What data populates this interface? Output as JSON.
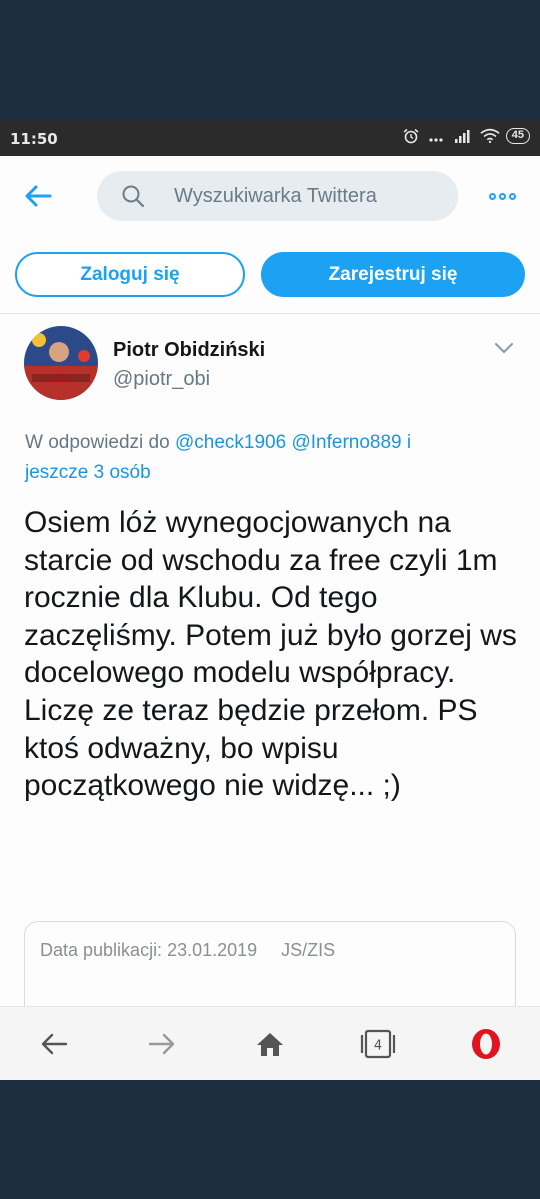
{
  "status": {
    "time": "11:50",
    "battery": "45",
    "icons": [
      "alarm-icon",
      "dots-icon",
      "signal-icon",
      "wifi-icon",
      "battery-icon"
    ]
  },
  "topbar": {
    "back_icon": "arrow-left-icon",
    "search_placeholder": "Wyszukiwarka Twittera",
    "more_icon": "more-horizontal-icon"
  },
  "auth": {
    "login_label": "Zaloguj się",
    "signup_label": "Zarejestruj się"
  },
  "tweet": {
    "author_name": "Piotr Obidziński",
    "author_handle": "@piotr_obi",
    "reply_prefix": "W odpowiedzi do",
    "reply_mentions": [
      "@check1906",
      "@Inferno889"
    ],
    "reply_suffix_link": "i",
    "reply_suffix_rest": "jeszcze 3 osób",
    "text": "Osiem lóż wynegocjowanych na starcie od wschodu za free czyli 1m rocznie dla Klubu. Od tego zaczęliśmy. Potem już było gorzej ws docelowego modelu współpracy. Liczę ze teraz będzie przełom. PS ktoś odważny, bo wpisu początkowego nie widzę... ;)",
    "card": {
      "date_label": "Data publikacji: 23.01.2019",
      "source": "JS/ZIS"
    }
  },
  "navbar": {
    "tabs_count": "4",
    "items": [
      "back-icon",
      "forward-icon",
      "home-icon",
      "tabs-icon",
      "opera-icon"
    ]
  },
  "colors": {
    "accent": "#1da1f2",
    "text": "#14171a",
    "muted": "#657786",
    "opera_red": "#e0131f",
    "frame": "#1c2e3f"
  }
}
